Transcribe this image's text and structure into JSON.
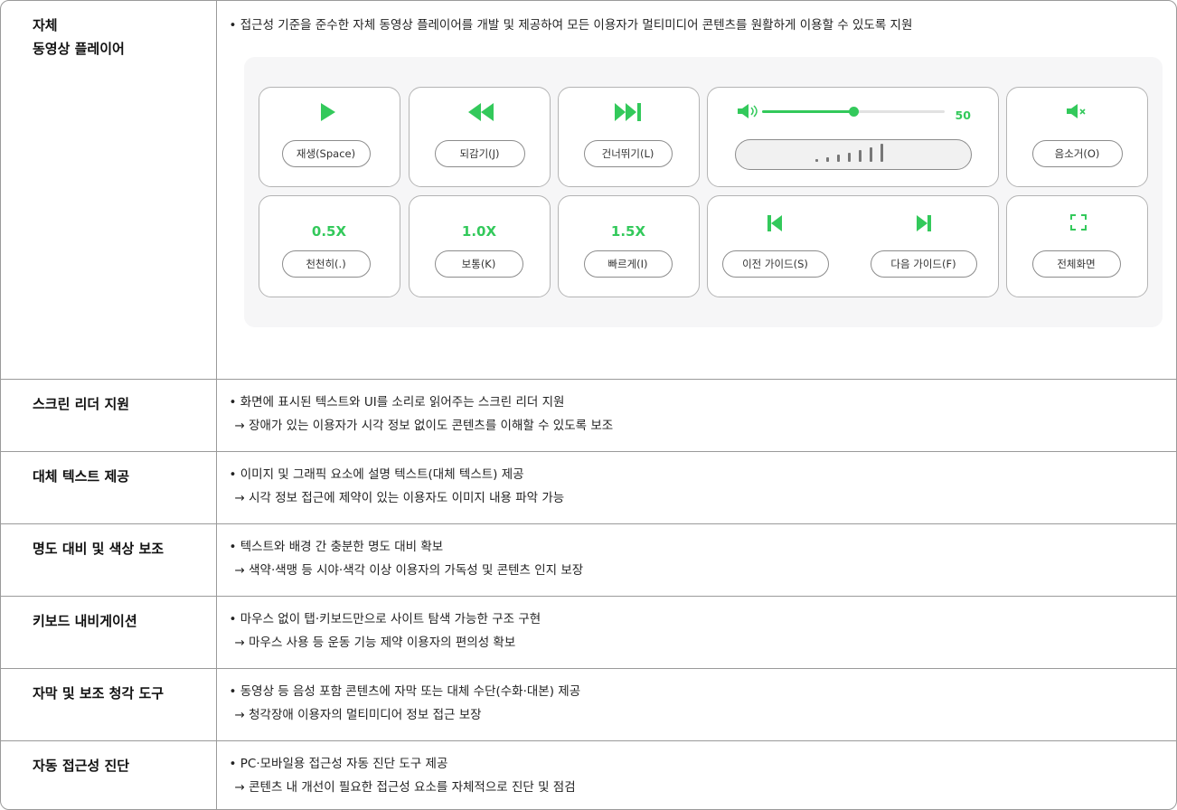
{
  "rows": [
    {
      "label": "자체\n동영상 플레이어",
      "desc1": "• 접근성 기준을 준수한 자체 동영상 플레이어를 개발 및 제공하여 모든 이용자가 멀티미디어 콘텐츠를 원활하게 이용할 수 있도록 지원",
      "desc2": ""
    },
    {
      "label": "스크린 리더 지원",
      "desc1": "• 화면에 표시된 텍스트와 UI를 소리로 읽어주는 스크린 리더 지원",
      "desc2": "→ 장애가 있는 이용자가 시각 정보 없이도 콘텐츠를 이해할 수 있도록 보조"
    },
    {
      "label": "대체 텍스트 제공",
      "desc1": "• 이미지 및 그래픽 요소에 설명 텍스트(대체 텍스트) 제공",
      "desc2": "→ 시각 정보 접근에 제약이 있는 이용자도 이미지 내용 파악 가능"
    },
    {
      "label": "명도 대비 및 색상 보조",
      "desc1": "• 텍스트와 배경 간 충분한 명도 대비 확보",
      "desc2": "→ 색약·색맹 등 시야·색각 이상 이용자의 가독성 및 콘텐츠 인지 보장"
    },
    {
      "label": "키보드 내비게이션",
      "desc1": "• 마우스 없이 탭·키보드만으로 사이트 탐색 가능한 구조 구현",
      "desc2": "→ 마우스 사용 등 운동 기능 제약 이용자의 편의성 확보"
    },
    {
      "label": "자막 및 보조 청각 도구",
      "desc1": "• 동영상 등 음성 포함 콘텐츠에 자막 또는 대체 수단(수화·대본) 제공",
      "desc2": "→ 청각장애 이용자의 멀티미디어 정보 접근 보장"
    },
    {
      "label": "자동 접근성 진단",
      "desc1": "• PC·모바일용 접근성 자동 진단 도구 제공",
      "desc2": "→ 콘텐츠 내 개선이 필요한 접근성 요소를 자체적으로 진단 및 점검"
    }
  ],
  "player": {
    "accent": "#33c95b",
    "play": "재생(Space)",
    "rewind": "되감기(J)",
    "skip": "건너뛰기(L)",
    "volume_value": "50",
    "volume_level": 0.5,
    "mute": "음소거(O)",
    "speed_slow_value": "0.5X",
    "speed_slow": "천천히(.)",
    "speed_normal_value": "1.0X",
    "speed_normal": "보통(K)",
    "speed_fast_value": "1.5X",
    "speed_fast": "빠르게(I)",
    "prev_guide": "이전 가이드(S)",
    "next_guide": "다음 가이드(F)",
    "fullscreen": "전체화면"
  }
}
